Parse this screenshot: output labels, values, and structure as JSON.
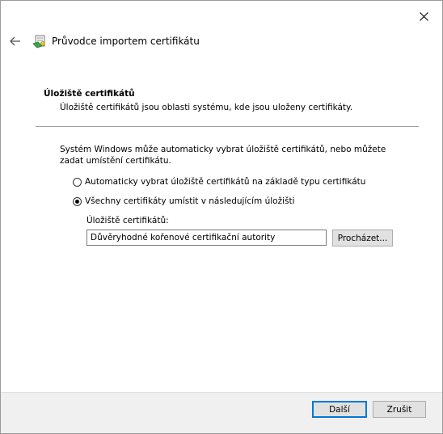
{
  "window": {
    "title": "Průvodce importem certifikátu",
    "close_icon": "close-icon",
    "back_icon": "back-arrow-icon",
    "wizard_icon": "certificate-wizard-icon"
  },
  "section": {
    "heading": "Úložiště certifikátů",
    "description": "Úložiště certifikátů jsou oblasti systému, kde jsou uloženy certifikáty."
  },
  "intro": "Systém Windows může automaticky vybrat úložiště certifikátů, nebo můžete zadat umístění certifikátu.",
  "options": [
    {
      "label": "Automaticky vybrat úložiště certifikátů na základě typu certifikátu",
      "checked": false
    },
    {
      "label": "Všechny certifikáty umístit v následujícím úložišti",
      "checked": true
    }
  ],
  "store": {
    "label": "Úložiště certifikátů:",
    "value": "Důvěryhodné kořenové certifikační autority",
    "browse_label": "Procházet..."
  },
  "footer": {
    "next_label": "Další",
    "cancel_label": "Zrušit"
  },
  "colors": {
    "accent": "#0078d7",
    "footer_bg": "#f0f0f0",
    "button_bg": "#e1e1e1"
  }
}
